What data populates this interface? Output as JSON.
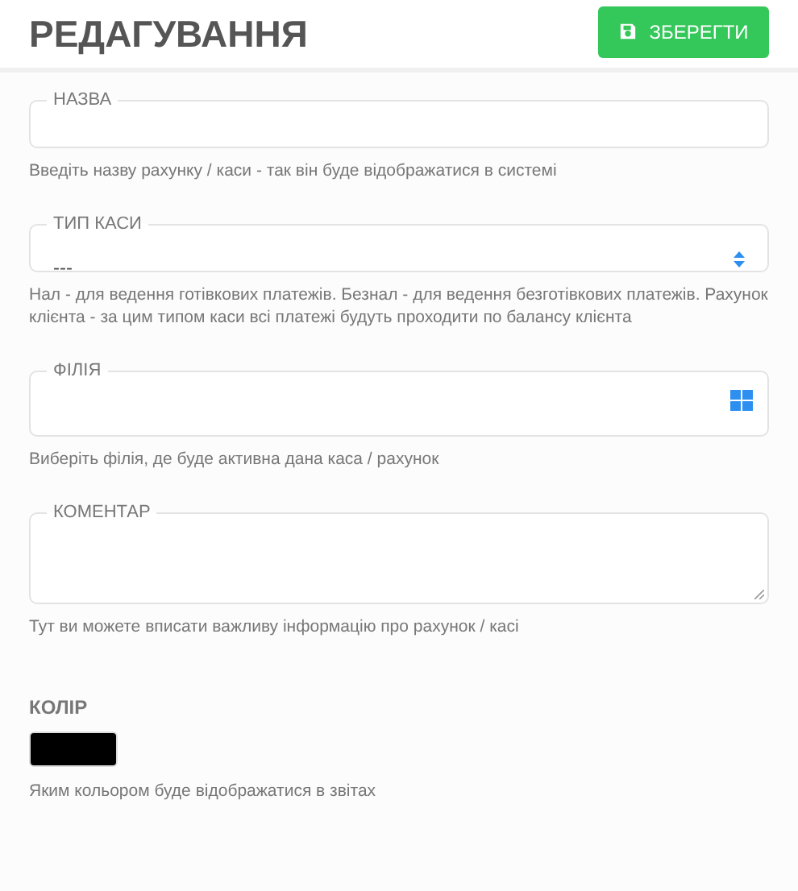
{
  "header": {
    "title": "РЕДАГУВАННЯ",
    "save_button": "ЗБЕРЕГТИ"
  },
  "fields": [
    {
      "kind": "text",
      "label": "НАЗВА",
      "hint": "Введіть назву рахунку / каси - так він буде відображатися в системі"
    },
    {
      "kind": "select",
      "label": "ТИП КАСИ",
      "value": "---",
      "hint": "Нал - для ведення готівкових платежів. Безнал - для ведення безготівкових платежів. Рахунок клієнта - за цим типом каси всі платежі будуть проходити по балансу клієнта"
    },
    {
      "kind": "picker",
      "label": "ФІЛІЯ",
      "hint": "Виберіть філія, де буде активна дана каса / рахунок"
    },
    {
      "kind": "textarea",
      "label": "КОМЕНТАР",
      "hint": "Тут ви можете вписати важливу інформацію про рахунок / касі"
    }
  ],
  "color_field": {
    "label": "КОЛІР",
    "color": "#000000",
    "hint": "Яким кольором буде відображатися в звітах"
  }
}
